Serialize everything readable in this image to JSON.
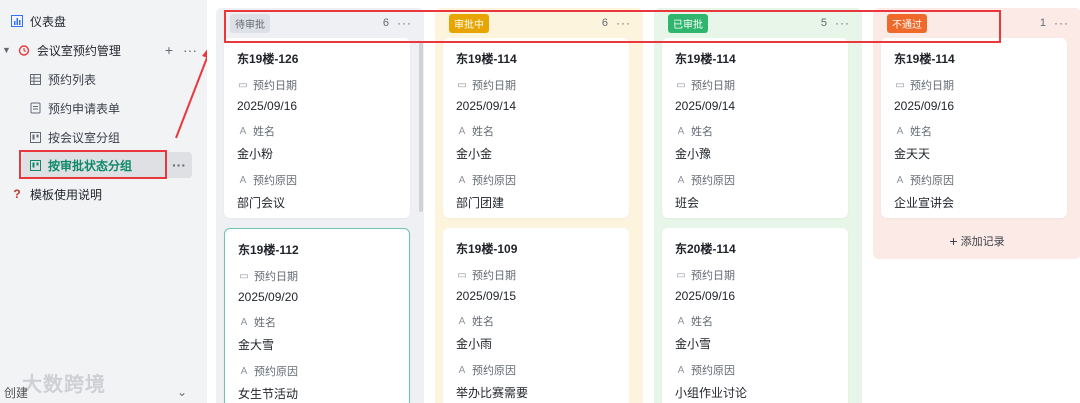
{
  "sidebar": {
    "dashboard": "仪表盘",
    "group": "会议室预约管理",
    "items": [
      {
        "label": "预约列表",
        "icon": "grid-table-icon"
      },
      {
        "label": "预约申请表单",
        "icon": "form-icon"
      },
      {
        "label": "按会议室分组",
        "icon": "kanban-icon"
      },
      {
        "label": "按审批状态分组",
        "icon": "kanban-icon"
      }
    ],
    "help": "模板使用说明",
    "bottom_label": "创建",
    "watermark": "大数跨境"
  },
  "fields": {
    "date": "预约日期",
    "name": "姓名",
    "reason": "预约原因"
  },
  "add_record": "添加记录",
  "columns": [
    {
      "status": "待审批",
      "count": "6",
      "tag_color": "#dde0e4",
      "tag_text": "#646a73",
      "bg": "#eef0f3",
      "cards": [
        {
          "title": "东19楼-126",
          "date": "2025/09/16",
          "name": "金小粉",
          "reason": "部门会议"
        },
        {
          "title": "东19楼-112",
          "date": "2025/09/20",
          "name": "金大雪",
          "reason": "女生节活动"
        }
      ]
    },
    {
      "status": "审批中",
      "count": "6",
      "tag_color": "#e8a400",
      "tag_text": "#ffffff",
      "bg": "#fcf4dd",
      "cards": [
        {
          "title": "东19楼-114",
          "date": "2025/09/14",
          "name": "金小金",
          "reason": "部门团建"
        },
        {
          "title": "东19楼-109",
          "date": "2025/09/15",
          "name": "金小雨",
          "reason": "举办比赛需要"
        }
      ]
    },
    {
      "status": "已审批",
      "count": "5",
      "tag_color": "#2fb56e",
      "tag_text": "#ffffff",
      "bg": "#e7f6e9",
      "cards": [
        {
          "title": "东19楼-114",
          "date": "2025/09/14",
          "name": "金小豫",
          "reason": "班会"
        },
        {
          "title": "东20楼-114",
          "date": "2025/09/16",
          "name": "金小雪",
          "reason": "小组作业讨论"
        }
      ]
    },
    {
      "status": "不通过",
      "count": "1",
      "tag_color": "#ef6a2a",
      "tag_text": "#ffffff",
      "bg": "#fbeae6",
      "cards": [
        {
          "title": "东19楼-114",
          "date": "2025/09/16",
          "name": "金天天",
          "reason": "企业宣讲会"
        }
      ]
    }
  ],
  "colors": {
    "highlight": "#e8383d",
    "active_nav": "#0e8a6a"
  }
}
